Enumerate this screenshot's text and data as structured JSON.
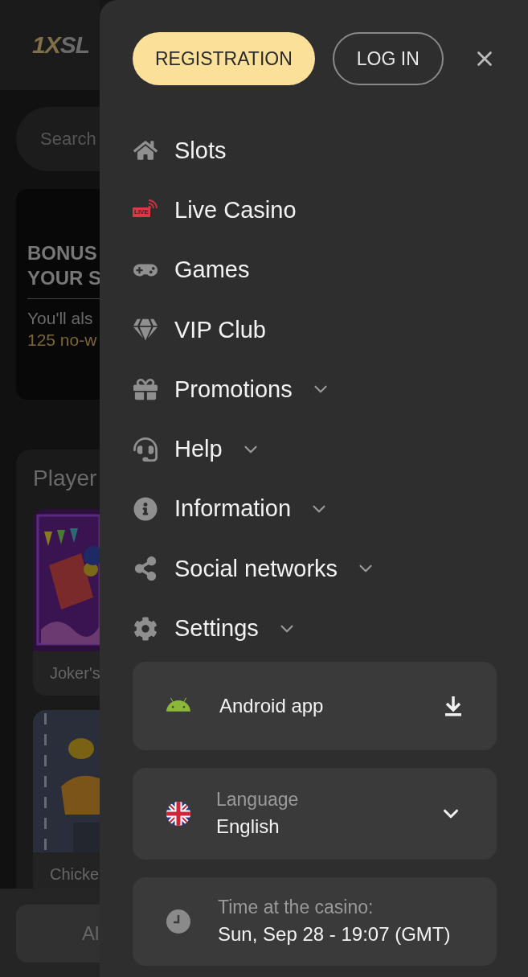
{
  "background_page": {
    "logo_accent": "1X",
    "logo_rest": "SL",
    "search": {
      "placeholder": "Search"
    },
    "banner": {
      "title_lines": [
        "BONUS",
        "YOUR S"
      ],
      "text": "You'll als",
      "highlight": "125 no-w"
    },
    "section_title": "Player",
    "games": [
      {
        "name": "Joker's",
        "kind": "picture"
      },
      {
        "name": "Chicke",
        "kind": "picture"
      }
    ],
    "bottom_button": "Al"
  },
  "menu": {
    "auth_buttons": [
      {
        "label": "REGISTRATION",
        "kind": "primary"
      },
      {
        "label": "LOG IN",
        "kind": "outline"
      }
    ],
    "items": [
      {
        "label": "Slots",
        "kind": "link"
      },
      {
        "label": "Live Casino",
        "kind": "link",
        "badge": "LIVE"
      },
      {
        "label": "Games",
        "kind": "link"
      },
      {
        "label": "VIP Club",
        "kind": "link"
      },
      {
        "label": "Promotions",
        "kind": "dropdown",
        "expanded": false
      },
      {
        "label": "Help",
        "kind": "dropdown",
        "expanded": false
      },
      {
        "label": "Information",
        "kind": "dropdown",
        "expanded": false
      },
      {
        "label": "Social networks",
        "kind": "dropdown",
        "expanded": false
      },
      {
        "label": "Settings",
        "kind": "dropdown",
        "expanded": false
      }
    ],
    "app_card": {
      "label": "Android app"
    },
    "language": {
      "label": "Language",
      "value": "English",
      "expanded": false
    },
    "time": {
      "label": "Time at the casino:",
      "value": "Sun, Sep 28 - 19:07 (GMT)"
    }
  }
}
